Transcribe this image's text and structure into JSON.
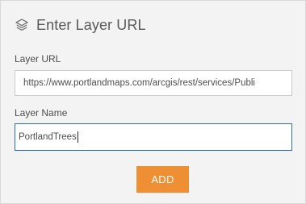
{
  "header": {
    "icon": "layers-icon",
    "title": "Enter Layer URL"
  },
  "layer_url": {
    "label": "Layer URL",
    "value": "https://www.portlandmaps.com/arcgis/rest/services/Publi"
  },
  "layer_name": {
    "label": "Layer Name",
    "value": "PortlandTrees"
  },
  "add_button": {
    "label": "ADD"
  },
  "colors": {
    "panel_background": "#f3f3f3",
    "accent": "#ee8f34",
    "focus_border": "#2f6bb3"
  }
}
